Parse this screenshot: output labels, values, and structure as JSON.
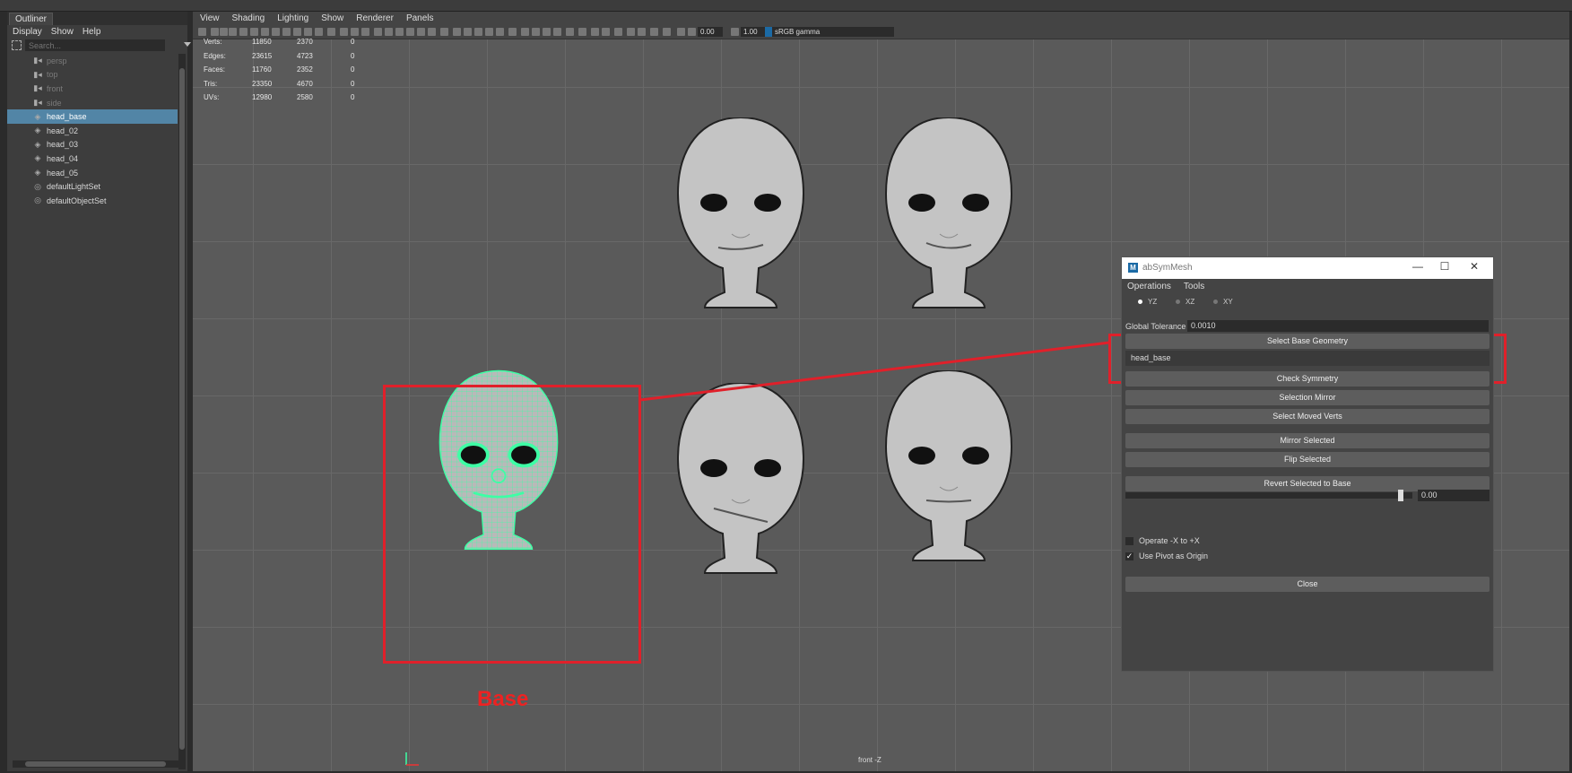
{
  "outliner": {
    "tab_label": "Outliner",
    "menu": [
      "Display",
      "Show",
      "Help"
    ],
    "search_placeholder": "Search...",
    "items": [
      {
        "label": "persp",
        "icon": "camera-icon",
        "dim": true
      },
      {
        "label": "top",
        "icon": "camera-icon",
        "dim": true
      },
      {
        "label": "front",
        "icon": "camera-icon",
        "dim": true
      },
      {
        "label": "side",
        "icon": "camera-icon",
        "dim": true
      },
      {
        "label": "head_base",
        "icon": "mesh-icon",
        "selected": true
      },
      {
        "label": "head_02",
        "icon": "mesh-icon"
      },
      {
        "label": "head_03",
        "icon": "mesh-icon"
      },
      {
        "label": "head_04",
        "icon": "mesh-icon"
      },
      {
        "label": "head_05",
        "icon": "mesh-icon"
      },
      {
        "label": "defaultLightSet",
        "icon": "set-icon"
      },
      {
        "label": "defaultObjectSet",
        "icon": "set-icon"
      }
    ]
  },
  "viewport": {
    "menu": [
      "View",
      "Shading",
      "Lighting",
      "Show",
      "Renderer",
      "Panels"
    ],
    "toolbar": {
      "exposure": "0.00",
      "gamma": "1.00",
      "color_space": "sRGB gamma"
    },
    "hud": [
      {
        "label": "Verts:",
        "a": "11850",
        "b": "2370",
        "c": "0"
      },
      {
        "label": "Edges:",
        "a": "23615",
        "b": "4723",
        "c": "0"
      },
      {
        "label": "Faces:",
        "a": "11760",
        "b": "2352",
        "c": "0"
      },
      {
        "label": "Tris:",
        "a": "23350",
        "b": "4670",
        "c": "0"
      },
      {
        "label": "UVs:",
        "a": "12980",
        "b": "2580",
        "c": "0"
      }
    ],
    "camera_label": "front -Z",
    "base_label": "Base"
  },
  "dialog": {
    "title": "abSymMesh",
    "menu": [
      "Operations",
      "Tools"
    ],
    "axes": [
      "YZ",
      "XZ",
      "XY"
    ],
    "selected_axis": "YZ",
    "tolerance_label": "Global Tolerance",
    "tolerance_value": "0.0010",
    "select_base_button": "Select Base Geometry",
    "base_field": "head_base",
    "buttons_a": [
      "Check Symmetry",
      "Selection Mirror",
      "Select Moved Verts"
    ],
    "buttons_b": [
      "Mirror Selected",
      "Flip Selected"
    ],
    "revert_button": "Revert Selected to Base",
    "slider_value": "0.00",
    "slider_fraction": 0.96,
    "operate_label": "Operate -X to +X",
    "operate_checked": false,
    "pivot_label": "Use Pivot as Origin",
    "pivot_checked": true,
    "close_button": "Close"
  },
  "colors": {
    "highlight_red": "#e0202a",
    "wireframe_green": "#3dffa5",
    "selection_blue": "#5285a6"
  }
}
